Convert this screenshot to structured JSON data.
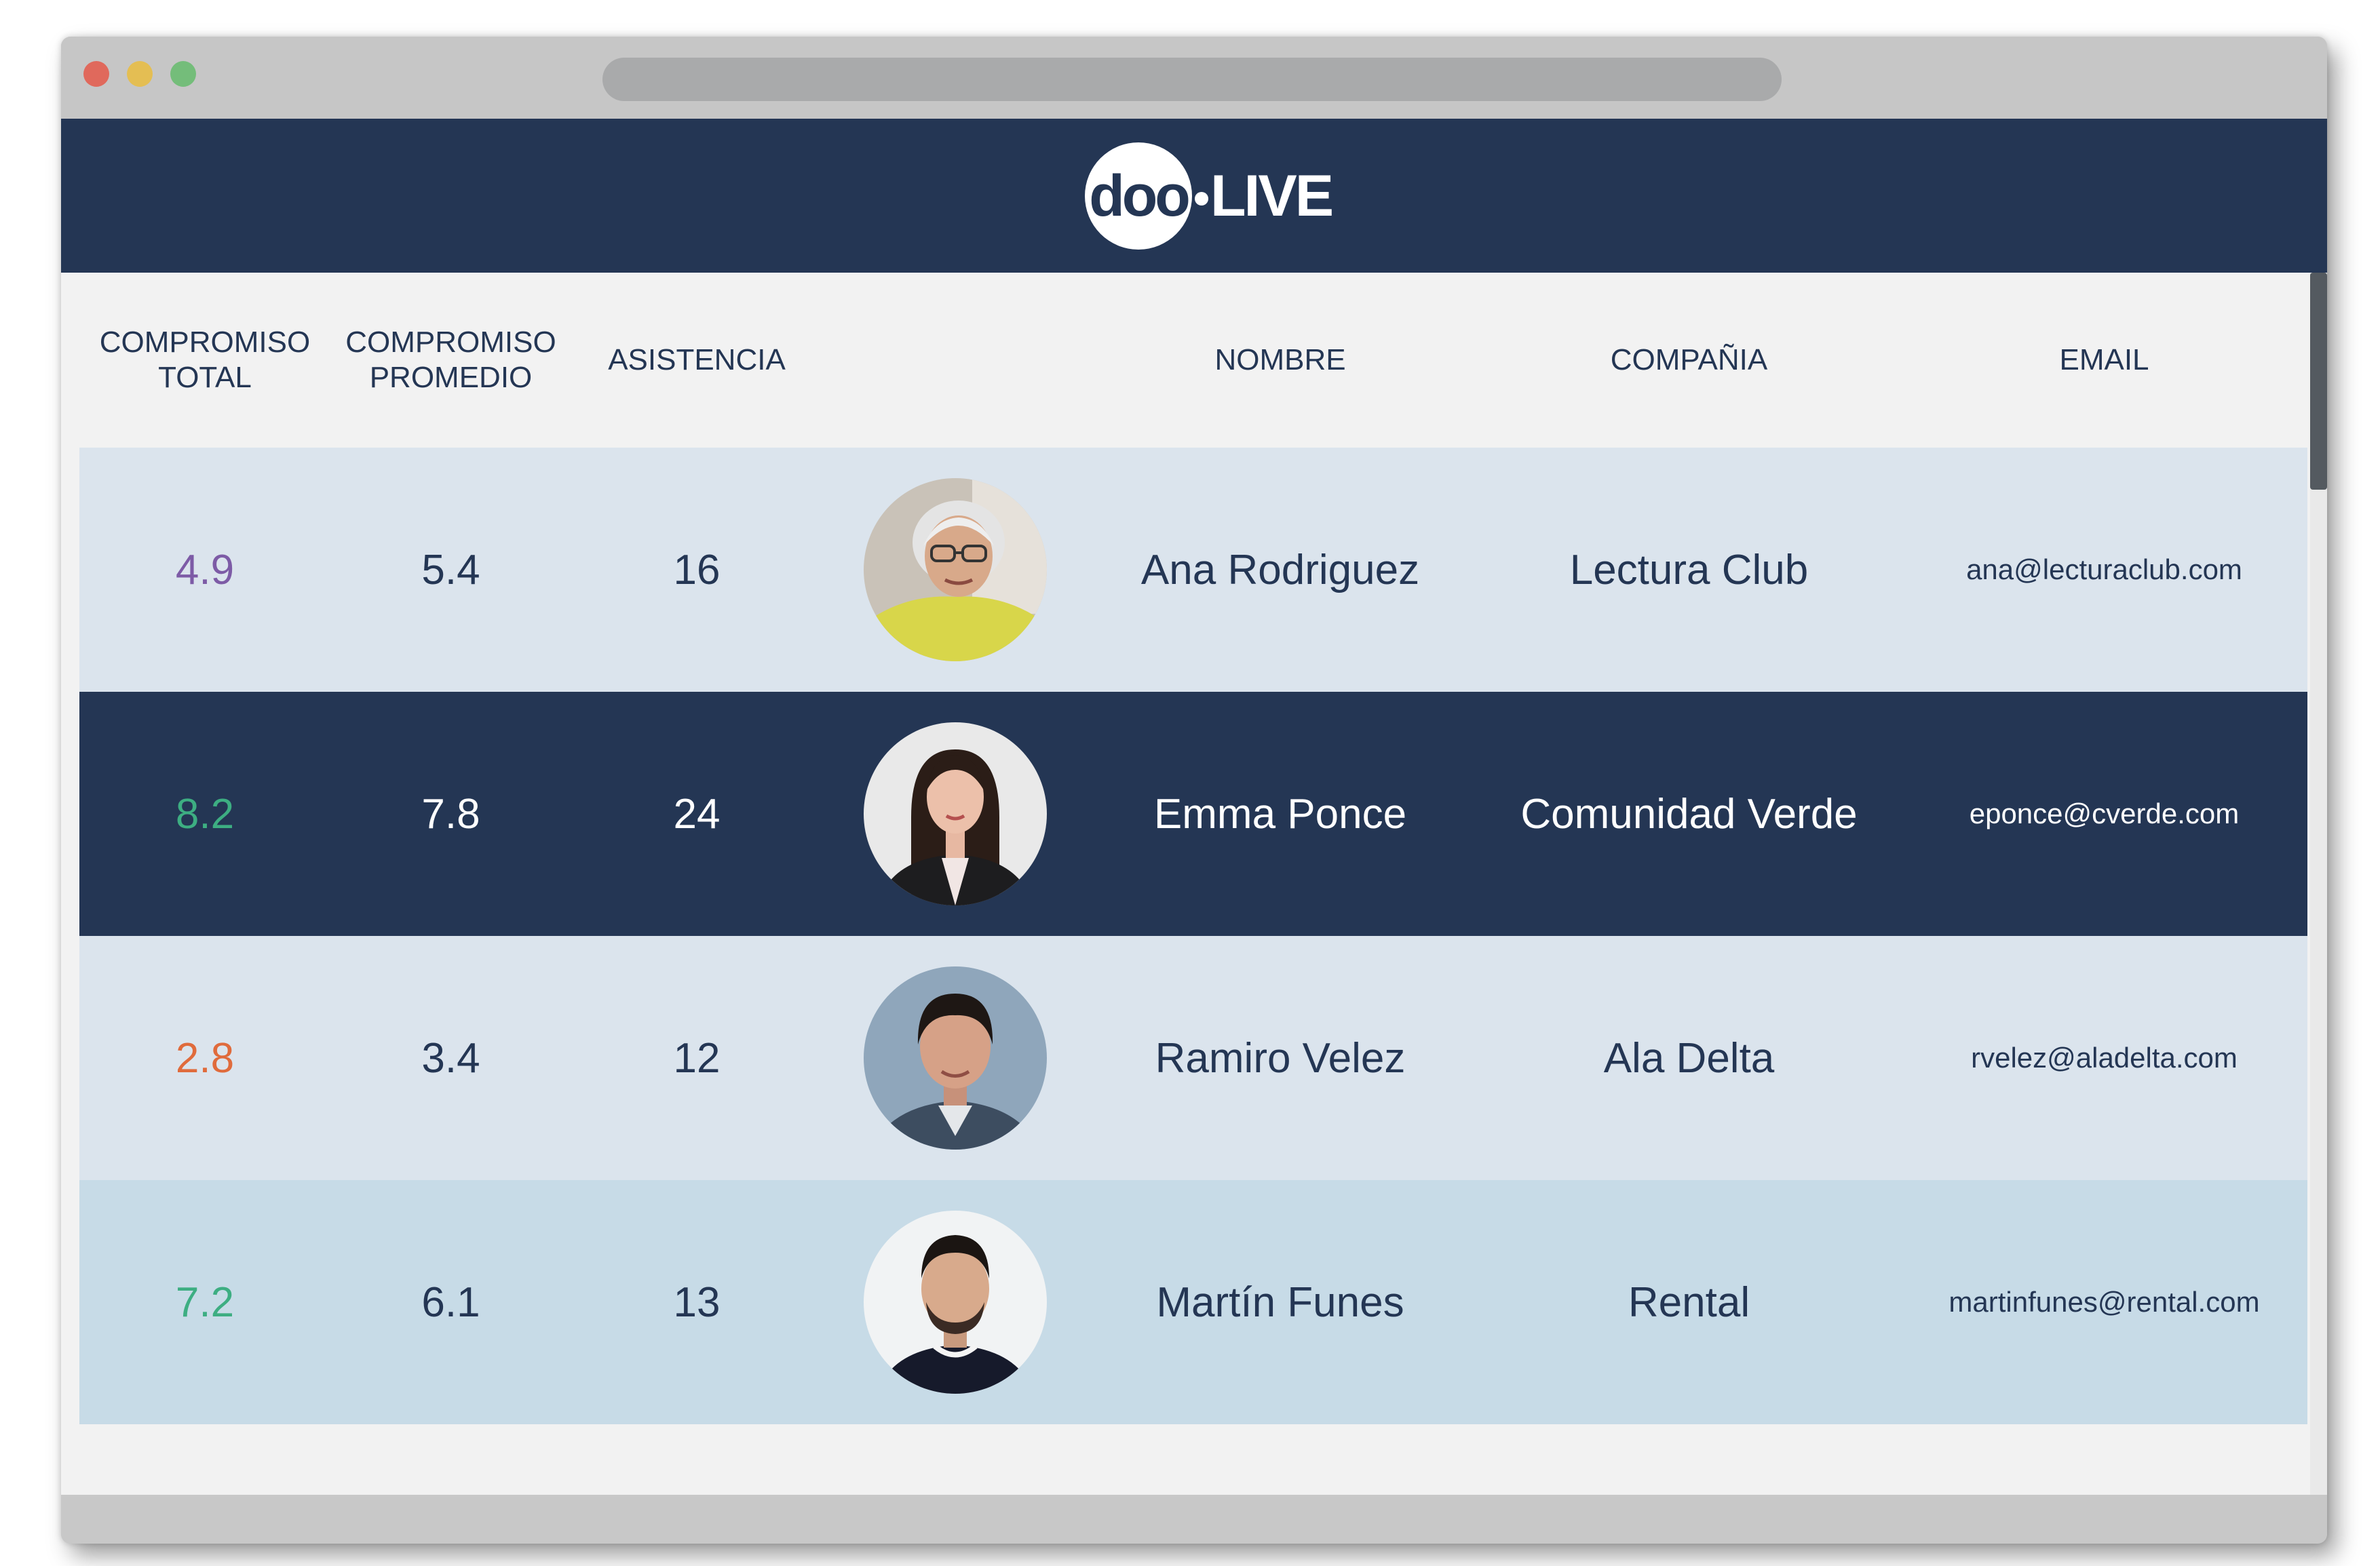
{
  "logo": {
    "brand_part": "doo",
    "live_part": "LIVE"
  },
  "colors": {
    "navy": "#243654",
    "row_light": "#dbe4ed",
    "row_lighter_blue": "#c7dbe7",
    "engagement_purple": "#7d5ba6",
    "engagement_green": "#3dae82",
    "engagement_orange": "#e06b3c"
  },
  "table": {
    "headers": {
      "compromiso_total": "COMPROMISO\nTOTAL",
      "compromiso_promedio": "COMPROMISO\nPROMEDIO",
      "asistencia": "ASISTENCIA",
      "nombre": "NOMBRE",
      "compania": "COMPAÑIA",
      "email": "EMAIL"
    },
    "rows": [
      {
        "compromiso_total": "4.9",
        "compromiso_promedio": "5.4",
        "asistencia": "16",
        "nombre": "Ana Rodriguez",
        "compania": "Lectura Club",
        "email": "ana@lecturaclub.com",
        "total_color": "#7d5ba6",
        "theme": "light"
      },
      {
        "compromiso_total": "8.2",
        "compromiso_promedio": "7.8",
        "asistencia": "24",
        "nombre": "Emma Ponce",
        "compania": "Comunidad Verde",
        "email": "eponce@cverde.com",
        "total_color": "#3dae82",
        "theme": "dark"
      },
      {
        "compromiso_total": "2.8",
        "compromiso_promedio": "3.4",
        "asistencia": "12",
        "nombre": "Ramiro Velez",
        "compania": "Ala Delta",
        "email": "rvelez@aladelta.com",
        "total_color": "#e06b3c",
        "theme": "light"
      },
      {
        "compromiso_total": "7.2",
        "compromiso_promedio": "6.1",
        "asistencia": "13",
        "nombre": "Martín Funes",
        "compania": "Rental",
        "email": "martinfunes@rental.com",
        "total_color": "#3dae82",
        "theme": "blue"
      }
    ]
  }
}
